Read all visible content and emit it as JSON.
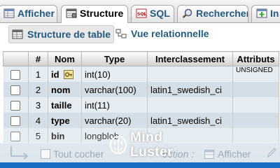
{
  "tabs": [
    {
      "label": "Afficher",
      "icon": "browse-icon",
      "active": false
    },
    {
      "label": "Structure",
      "icon": "structure-icon",
      "active": true
    },
    {
      "label": "SQL",
      "icon": "sql-icon",
      "active": false
    },
    {
      "label": "Rechercher",
      "icon": "search-icon",
      "active": false
    },
    {
      "label": "In",
      "icon": "insert-icon",
      "active": false
    }
  ],
  "subnav": {
    "table_structure": "Structure de table",
    "relational_view": "Vue relationnelle"
  },
  "table": {
    "headers": [
      "",
      "#",
      "Nom",
      "Type",
      "Interclassement",
      "Attributs"
    ],
    "rows": [
      {
        "num": "1",
        "name": "id",
        "type": "int(10)",
        "collation": "",
        "attributes": "UNSIGNED",
        "primary_key": true
      },
      {
        "num": "2",
        "name": "nom",
        "type": "varchar(100)",
        "collation": "latin1_swedish_ci",
        "attributes": ""
      },
      {
        "num": "3",
        "name": "taille",
        "type": "int(11)",
        "collation": "",
        "attributes": ""
      },
      {
        "num": "4",
        "name": "type",
        "type": "varchar(20)",
        "collation": "latin1_swedish_ci",
        "attributes": ""
      },
      {
        "num": "5",
        "name": "bin",
        "type": "longblob",
        "collation": "",
        "attributes": ""
      }
    ]
  },
  "bottom": {
    "check_all": "Tout cocher",
    "selection": "ection :",
    "browse": "Afficher"
  },
  "watermark": {
    "line1": "Mind",
    "line2": "Luster"
  },
  "colors": {
    "link": "#235a81",
    "row_odd": "#e6edf2",
    "row_even": "#d4dee6",
    "accent": "#1a6fc4"
  }
}
